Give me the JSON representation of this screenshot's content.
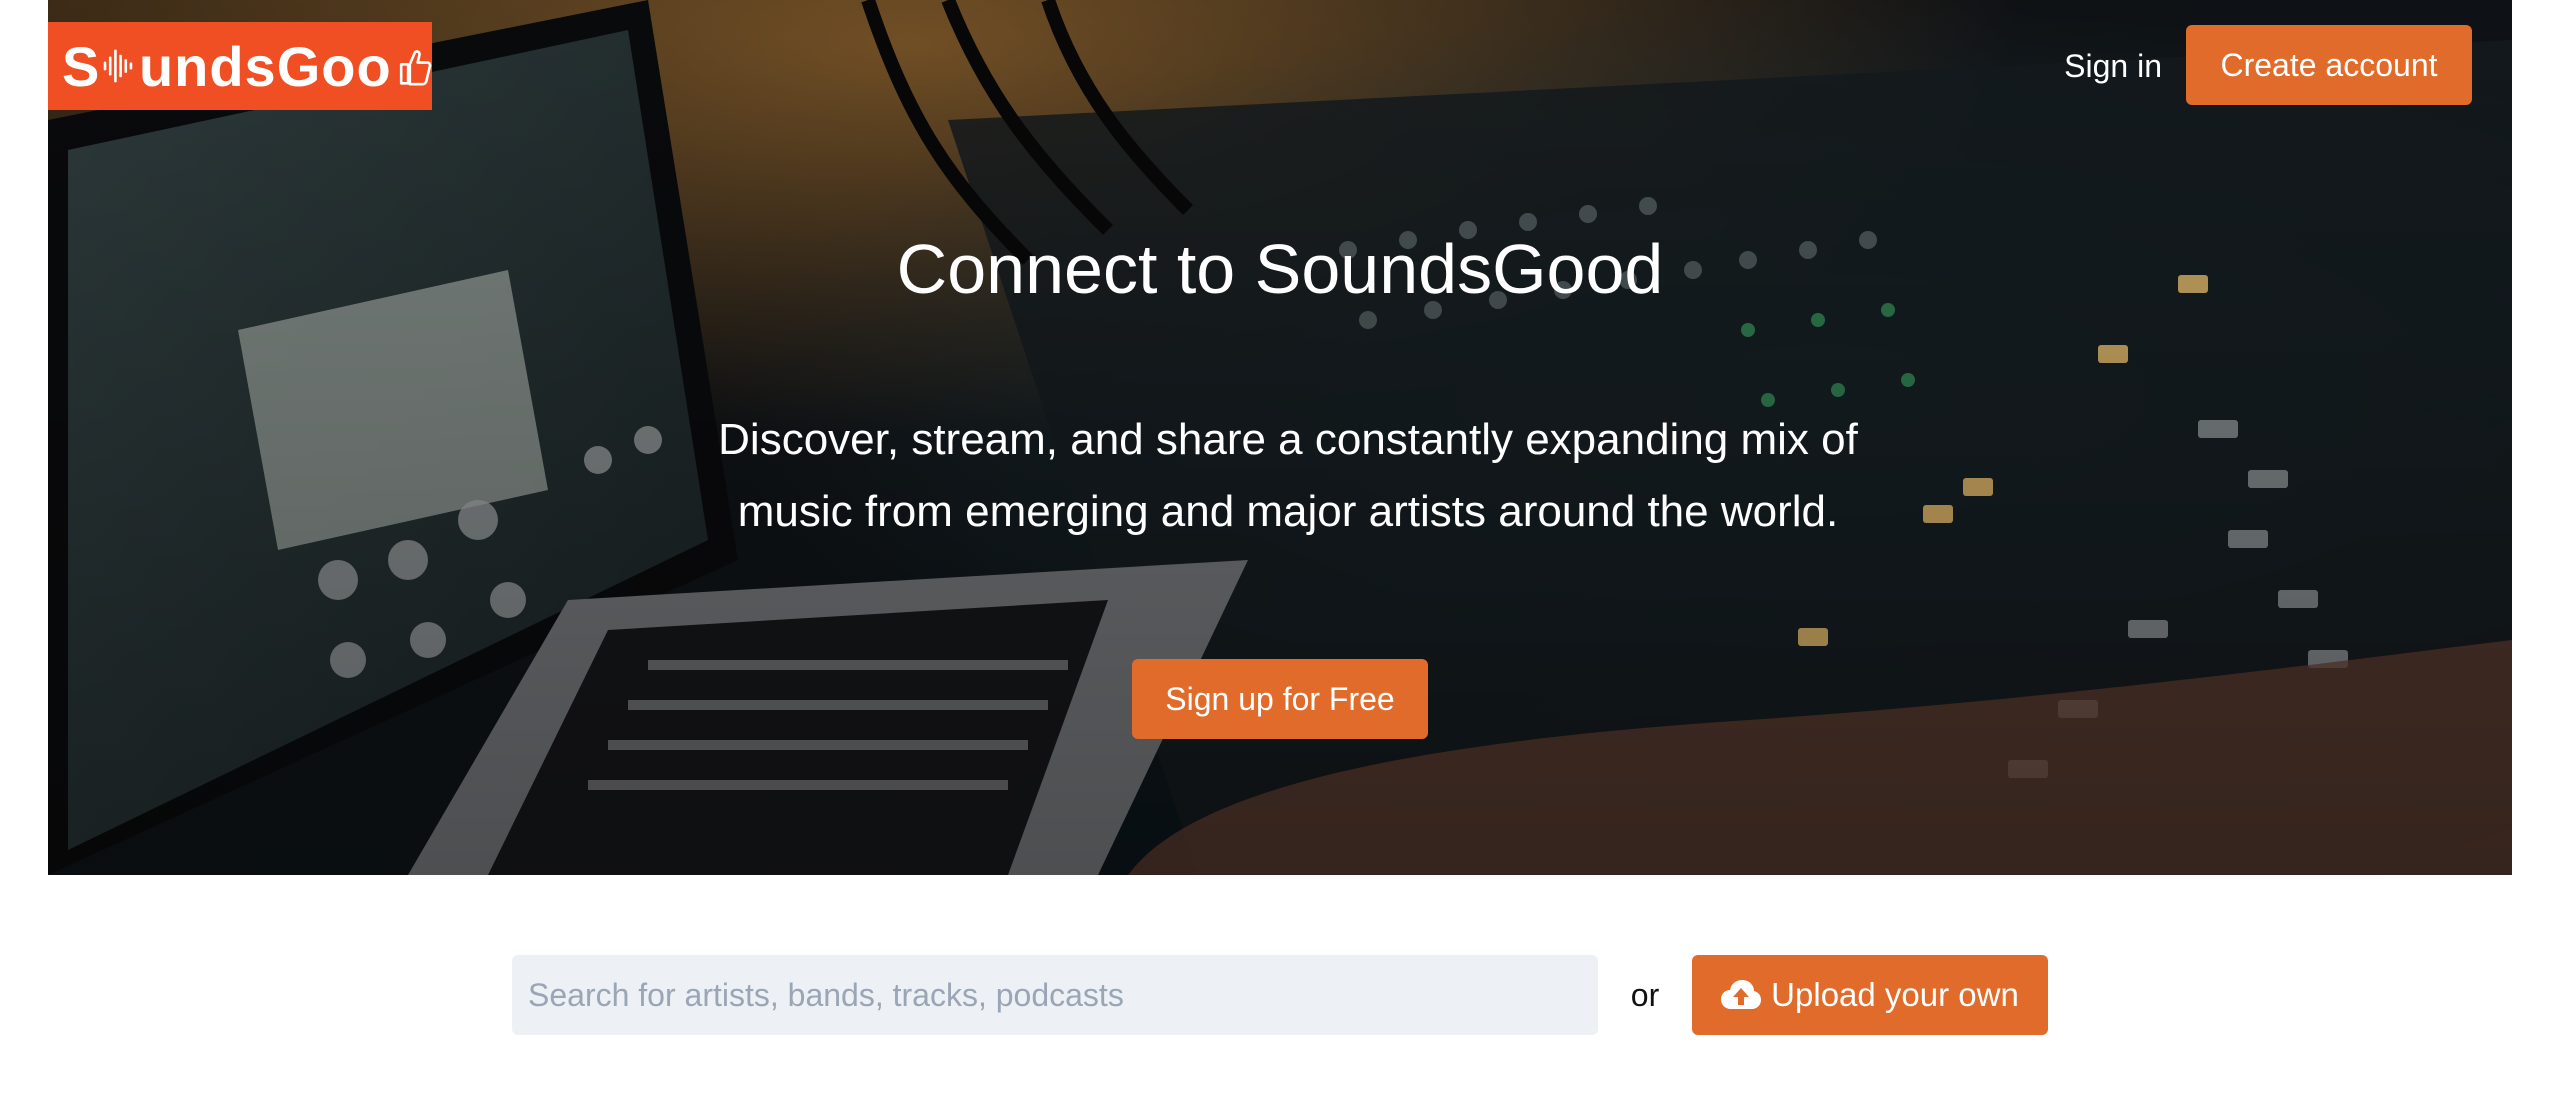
{
  "brand": {
    "logo_text": "SoundsGood",
    "accent_color": "#f04e23",
    "button_color": "#e06b2a"
  },
  "nav": {
    "signin_label": "Sign in",
    "create_account_label": "Create account"
  },
  "hero": {
    "headline": "Connect to SoundsGood",
    "tagline": "Discover, stream, and share a constantly expanding mix of music from emerging and major artists around the world.",
    "cta_label": "Sign up for Free"
  },
  "search": {
    "placeholder": "Search for artists, bands, tracks, podcasts",
    "or_label": "or",
    "upload_label": "Upload your own",
    "upload_icon": "cloud-upload-icon"
  }
}
